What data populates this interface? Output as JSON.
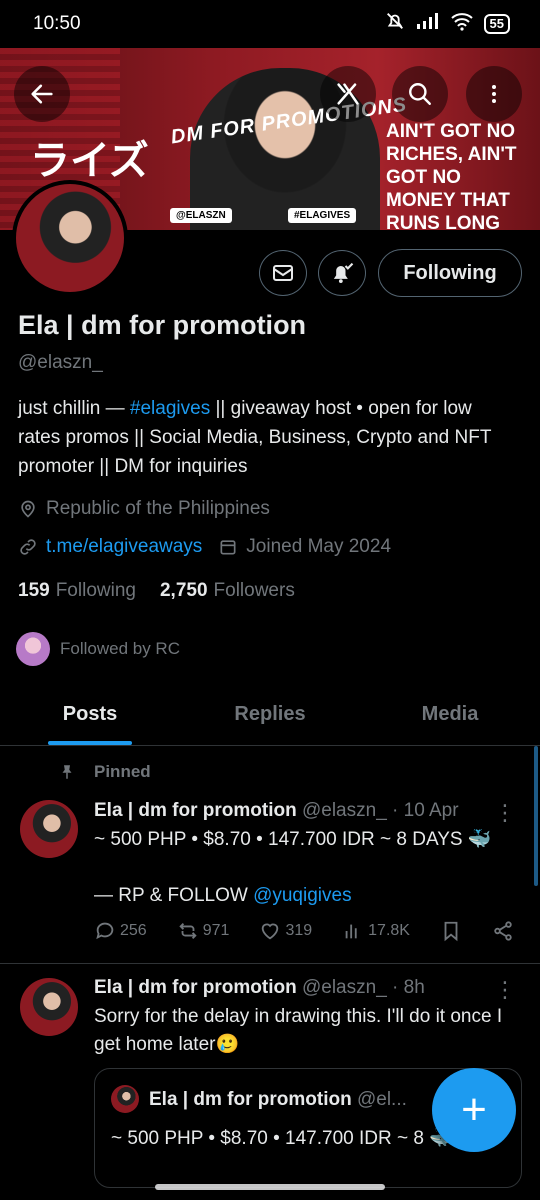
{
  "status_bar": {
    "time": "10:50",
    "battery": "55"
  },
  "banner": {
    "promo_text": "DM FOR PROMOTIONS",
    "slogan": "AIN'T GOT NO RICHES, AIN'T GOT NO MONEY THAT RUNS LONG",
    "tag_left": "@ELASZN",
    "tag_right": "#ELAGIVES",
    "jp_text": "ライズ"
  },
  "header": {
    "following_button": "Following"
  },
  "profile": {
    "name": "Ela | dm for promotion",
    "handle": "@elaszn_",
    "bio_before": "just chillin — ",
    "bio_hashtag": "#elagives",
    "bio_after": " || giveaway host • open for low rates promos || Social Media, Business, Crypto and NFT promoter || DM for inquiries",
    "location": "Republic of the Philippines",
    "link": "t.me/elagiveaways",
    "joined": "Joined May 2024",
    "following_count": "159",
    "following_label": "Following",
    "followers_count": "2,750",
    "followers_label": "Followers",
    "followed_by": "Followed by RC"
  },
  "tabs": [
    "Posts",
    "Replies",
    "Media"
  ],
  "posts": [
    {
      "pinned_label": "Pinned",
      "author": "Ela | dm for promotion",
      "meta": "@elaszn_ · 10 Apr",
      "text_line1": "~ 500 PHP • $8.70 • 147.700 IDR ~ 8 DAYS 🐳",
      "text_line2_prefix": "— RP & FOLLOW ",
      "text_line2_mention": "@yuqigives",
      "replies": "256",
      "reposts": "971",
      "likes": "319",
      "views": "17.8K"
    },
    {
      "author": "Ela | dm for promotion",
      "meta": "@elaszn_ · 8h",
      "text": "Sorry for the delay in drawing this. I'll do it once I get home later🥲",
      "quote_author": "Ela | dm for promotion",
      "quote_meta": "@el...",
      "quote_text": "~ 500 PHP • $8.70 • 147.700 IDR ~ 8 🐳"
    }
  ],
  "fab_label": "+"
}
